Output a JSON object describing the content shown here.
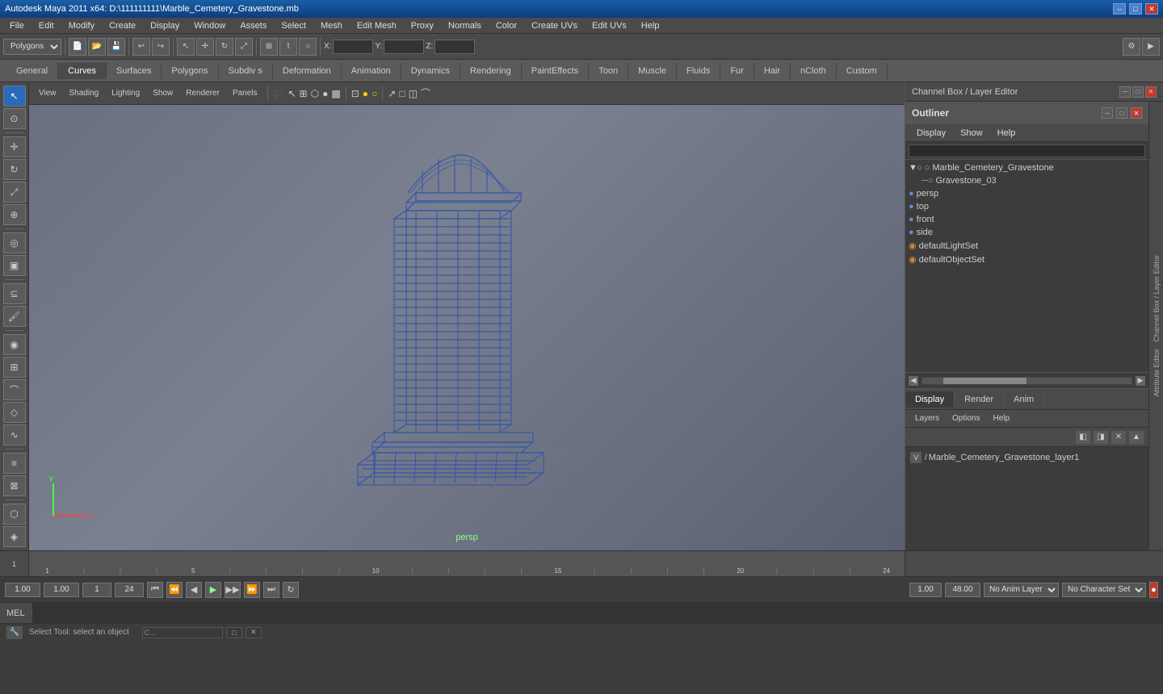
{
  "titlebar": {
    "title": "Autodesk Maya 2011 x64: D:\\111111111\\Marble_Cemetery_Gravestone.mb",
    "minimize": "–",
    "maximize": "□",
    "close": "✕"
  },
  "menubar": {
    "items": [
      "File",
      "Edit",
      "Modify",
      "Create",
      "Display",
      "Window",
      "Assets",
      "Select",
      "Mesh",
      "Edit Mesh",
      "Proxy",
      "Normals",
      "Color",
      "Create UVs",
      "Edit UVs",
      "Help"
    ]
  },
  "toolbar": {
    "mode_select": "Polygons",
    "z_label": "Z:",
    "x_label": "X:",
    "y_label": "Y:"
  },
  "shelf_tabs": {
    "items": [
      "General",
      "Curves",
      "Surfaces",
      "Polygons",
      "Subdiv s",
      "Deformation",
      "Animation",
      "Dynamics",
      "Rendering",
      "PaintEffects",
      "Toon",
      "Muscle",
      "Fluids",
      "Fur",
      "Hair",
      "nCloth",
      "Custom"
    ]
  },
  "viewport": {
    "menus": [
      "View",
      "Shading",
      "Lighting",
      "Show",
      "Renderer",
      "Panels"
    ],
    "axes_x": "X",
    "axes_y": "Y",
    "pan_label": "persp",
    "resolution_gate": ""
  },
  "outliner": {
    "title": "Outliner",
    "menus": [
      "Display",
      "Show",
      "Help"
    ],
    "tree_items": [
      {
        "indent": 0,
        "icon": "▼",
        "type": "group",
        "name": "Marble_Cemetery_Gravestone",
        "has_arrow": true
      },
      {
        "indent": 1,
        "icon": "─○",
        "type": "mesh",
        "name": "Gravestone_03",
        "has_arrow": false
      },
      {
        "indent": 0,
        "icon": "●",
        "type": "camera",
        "name": "persp",
        "has_arrow": false
      },
      {
        "indent": 0,
        "icon": "●",
        "type": "camera",
        "name": "top",
        "has_arrow": false
      },
      {
        "indent": 0,
        "icon": "●",
        "type": "camera",
        "name": "front",
        "has_arrow": false
      },
      {
        "indent": 0,
        "icon": "●",
        "type": "camera",
        "name": "side",
        "has_arrow": false
      },
      {
        "indent": 0,
        "icon": "◉",
        "type": "light_set",
        "name": "defaultLightSet",
        "has_arrow": false
      },
      {
        "indent": 0,
        "icon": "◉",
        "type": "object_set",
        "name": "defaultObjectSet",
        "has_arrow": false
      }
    ]
  },
  "layer_panel": {
    "tabs": [
      "Display",
      "Render",
      "Anim"
    ],
    "active_tab": "Display",
    "menus": [
      "Layers",
      "Options",
      "Help"
    ],
    "layers": [
      {
        "visible": "V",
        "name": "Marble_Cemetery_Gravestone_layer1"
      }
    ]
  },
  "timeline": {
    "start": "1",
    "end": "24",
    "marks": [
      "1",
      "",
      "",
      "",
      "5",
      "",
      "",
      "",
      "",
      "10",
      "",
      "",
      "",
      "",
      "15",
      "",
      "",
      "",
      "",
      "20",
      "",
      "",
      "",
      "24"
    ],
    "current_frame": "1.00"
  },
  "playback": {
    "current_frame": "1.00",
    "range_start": "1",
    "range_end": "24",
    "fps_start": "1.00",
    "fps_end": "48.00",
    "anim_layer": "No Anim Layer",
    "character_set": "No Character Set",
    "play_btns": [
      "⏮",
      "⏭",
      "⏪",
      "◀",
      "▶",
      "⏩",
      "⏭",
      "⏭"
    ]
  },
  "command_bar": {
    "label": "MEL",
    "placeholder": ""
  },
  "status_bar": {
    "text": "Select Tool: select an object"
  },
  "channel_box": {
    "title": "Channel Box / Layer Editor"
  },
  "icons": {
    "chevron_down": "▼",
    "chevron_right": "▶",
    "search": "🔍",
    "gear": "⚙",
    "minimize": "─",
    "restore": "□",
    "close": "✕"
  }
}
